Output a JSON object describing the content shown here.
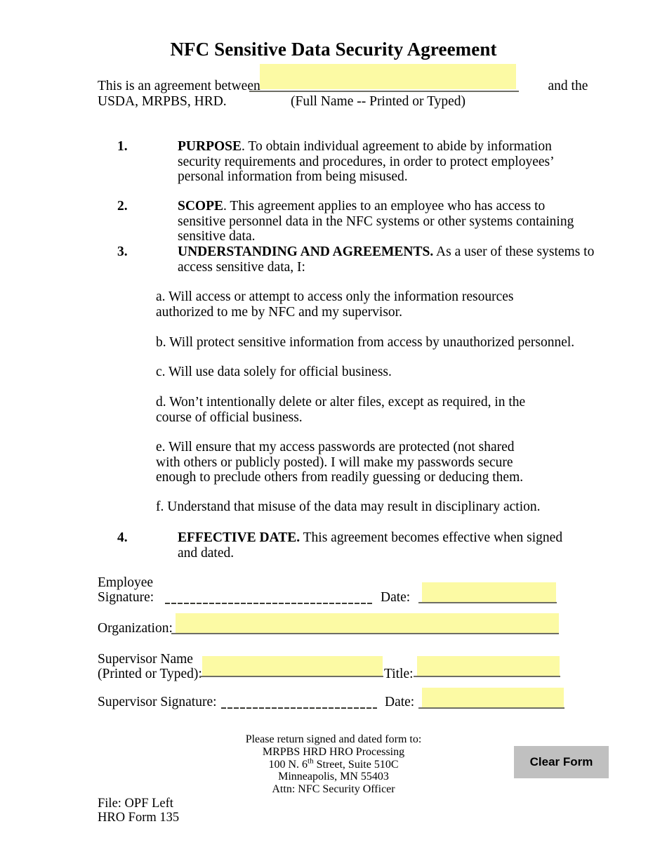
{
  "document": {
    "title": "NFC Sensitive Data Security Agreement",
    "intro": {
      "before_field": "This is an agreement between ",
      "after_field": " and the",
      "line2": "USDA, MRPBS, HRD.",
      "field_caption": "(Full Name -- Printed or Typed)",
      "full_name_value": "",
      "full_name_placeholder": ""
    },
    "sections": [
      {
        "number": "1.",
        "heading": "PURPOSE",
        "heading_suffix": ".",
        "text": "   To obtain individual agreement to abide by information security requirements and procedures, in order to protect employees’ personal information from being misused."
      },
      {
        "number": "2.",
        "heading": "SCOPE",
        "heading_suffix": ".",
        "text": "   This agreement applies to an employee who has access to sensitive personnel data in the NFC systems or other systems containing sensitive data."
      },
      {
        "number": "3.",
        "heading": "UNDERSTANDING AND AGREEMENTS.",
        "heading_suffix": "",
        "text": "   As a user of these systems to access sensitive data, I:"
      },
      {
        "number": "4.",
        "heading": "EFFECTIVE DATE.",
        "heading_suffix": "",
        "text": "   This agreement becomes effective when signed and dated."
      }
    ],
    "subitems": [
      {
        "letter": "a.",
        "text": "   Will access or attempt to access only the information resources authorized to me by NFC and my supervisor."
      },
      {
        "letter": "b.",
        "text": "   Will protect sensitive information from access by unauthorized personnel."
      },
      {
        "letter": "c.",
        "text": "   Will use data solely for official business."
      },
      {
        "letter": "d.",
        "text": "   Won’t intentionally delete or alter files, except as required, in the course of official business."
      },
      {
        "letter": "e.",
        "text": "   Will ensure that my access passwords are protected (not shared with others or publicly posted).  I will make my passwords secure enough to preclude others from readily guessing or deducing them."
      },
      {
        "letter": "f.",
        "text": "   Understand that misuse of the data may result in disciplinary action."
      }
    ],
    "signature_block": {
      "employee_label_line1": "Employee",
      "employee_label_line2": "Signature:",
      "employee_date_label": "Date:",
      "employee_date_value": "",
      "organization_label": "Organization:",
      "organization_value": "",
      "supervisor_name_label_line1": "Supervisor Name",
      "supervisor_name_label_line2": "(Printed or Typed):",
      "supervisor_name_value": "",
      "title_label": "Title:",
      "title_value": "",
      "supervisor_signature_label": "Supervisor Signature:",
      "supervisor_date_label": "Date:",
      "supervisor_date_value": ""
    },
    "footer": {
      "line1": "Please return signed and dated form to:",
      "line2": "MRPBS HRD HRO Processing",
      "line3_pre": "100 N. 6",
      "line3_sup": "th",
      "line3_post": " Street, Suite 510C",
      "line4": "Minneapolis, MN 55403",
      "line5": "Attn: NFC Security Officer"
    },
    "file_note": {
      "line1": "File: OPF Left",
      "line2": "HRO Form 135"
    },
    "buttons": {
      "clear_form": "Clear Form"
    },
    "colors": {
      "field_fill": "#fcfaa4",
      "button_face": "#c0c0c0",
      "rule": "#6e6e64",
      "text": "#000000"
    }
  }
}
